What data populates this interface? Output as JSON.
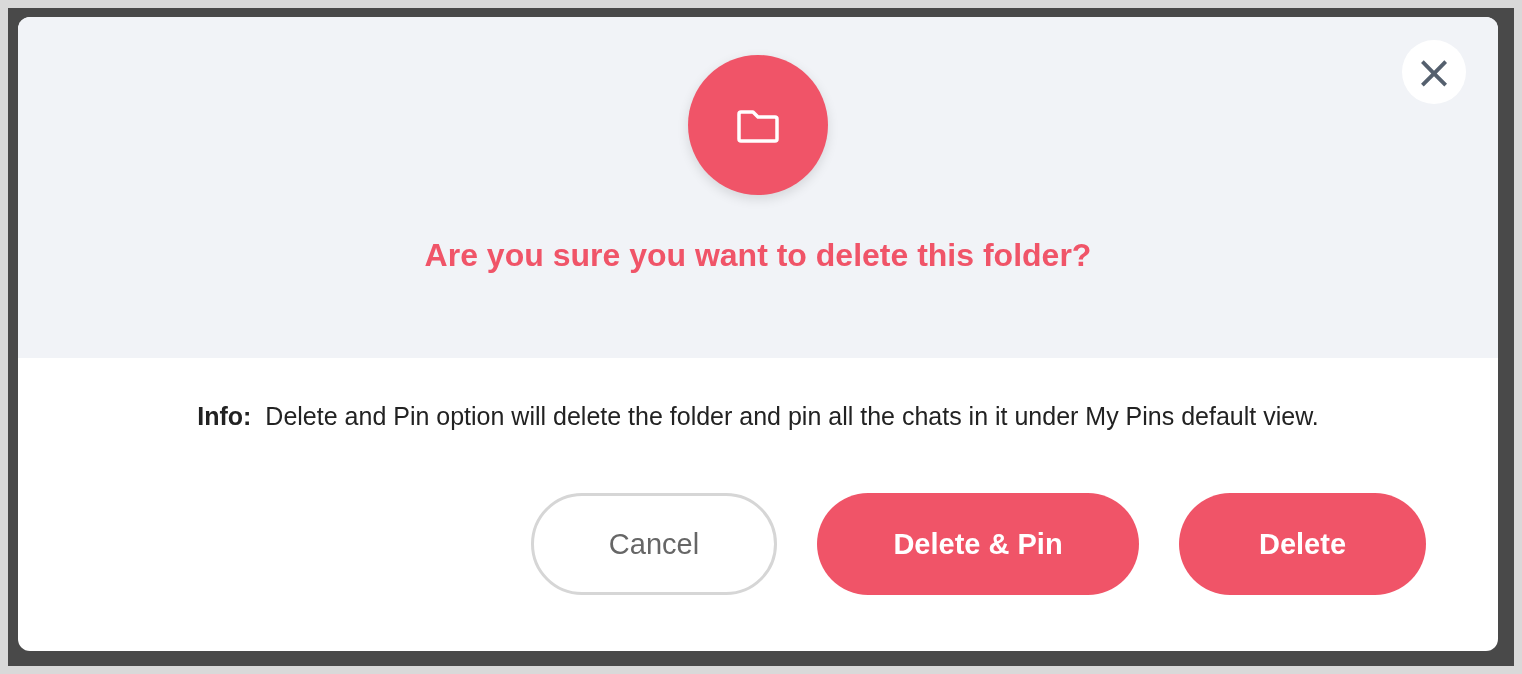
{
  "dialog": {
    "title": "Are you sure you want to delete this folder?",
    "close": "×",
    "info_label": "Info:",
    "info_text": "Delete and Pin option will delete the folder and pin all the chats in it under My Pins default view.",
    "buttons": [
      {
        "label": "Cancel",
        "kind": "secondary"
      },
      {
        "label": "Delete & Pin",
        "kind": "primary"
      },
      {
        "label": "Delete",
        "kind": "primary"
      }
    ]
  }
}
